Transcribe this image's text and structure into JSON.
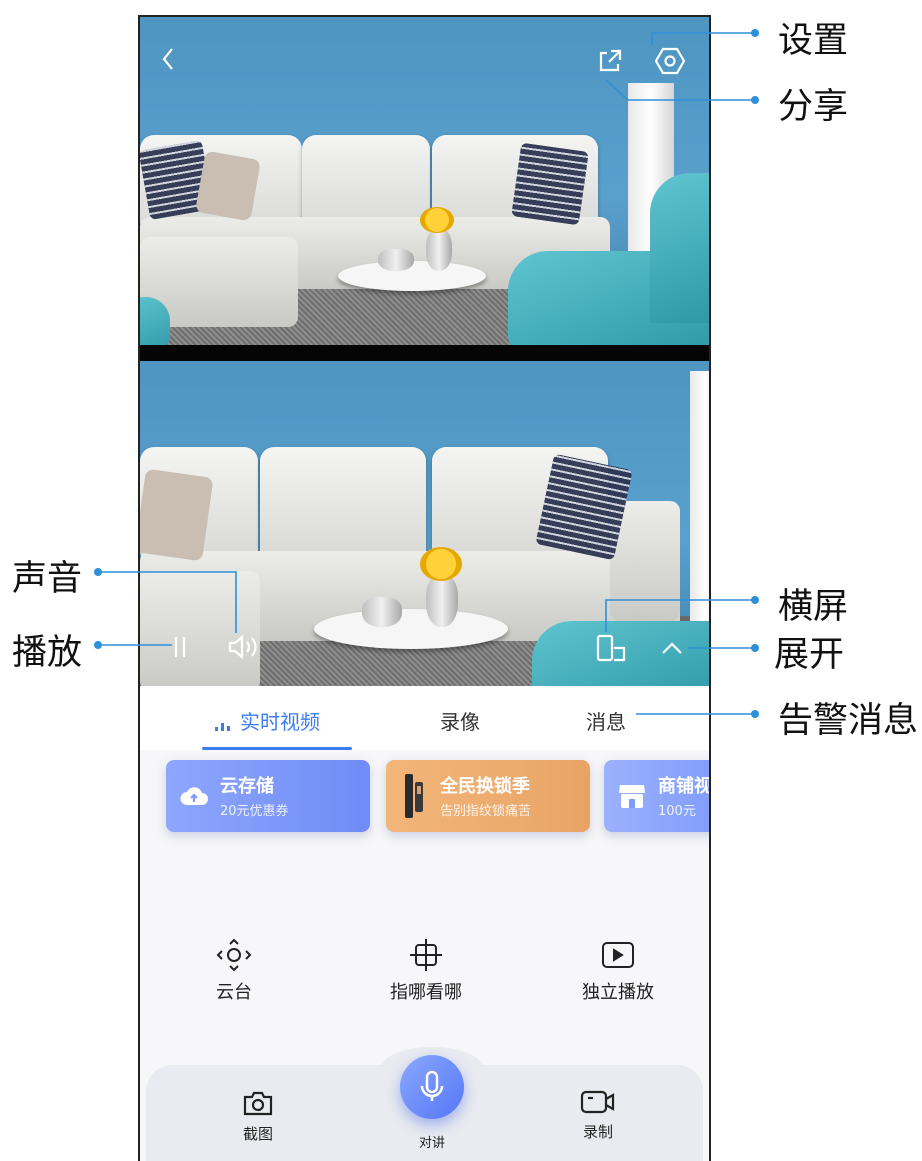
{
  "tabs": [
    {
      "label": "实时视频",
      "active": true
    },
    {
      "label": "录像",
      "active": false
    },
    {
      "label": "消息",
      "active": false
    }
  ],
  "cards": [
    {
      "title": "云存储",
      "subtitle": "20元优惠券",
      "icon": "cloud-upload-icon",
      "color": "#7f9cfb"
    },
    {
      "title": "全民换锁季",
      "subtitle": "告别指纹锁痛苦",
      "icon": "door-lock-icon",
      "color": "#efac6d"
    },
    {
      "title": "商铺视",
      "subtitle": "100元",
      "icon": "store-icon",
      "color": "#8aa6fb"
    }
  ],
  "functions": [
    {
      "label": "云台",
      "icon": "ptz-icon"
    },
    {
      "label": "指哪看哪",
      "icon": "crosshair-icon"
    },
    {
      "label": "独立播放",
      "icon": "play-icon"
    }
  ],
  "bottom_bar": {
    "screenshot_label": "截图",
    "talk_label": "对讲",
    "record_label": "录制"
  },
  "overlay_icons": [
    "back-icon",
    "share-icon",
    "settings-icon",
    "pause-icon",
    "volume-icon",
    "landscape-icon",
    "expand-icon"
  ],
  "callouts": {
    "settings": "设置",
    "share": "分享",
    "sound": "声音",
    "play": "播放",
    "landscape": "横屏",
    "expand": "展开",
    "alert_messages": "告警消息"
  },
  "colors": {
    "accent": "#3b7df0",
    "callout_line": "#2f8fd8"
  }
}
